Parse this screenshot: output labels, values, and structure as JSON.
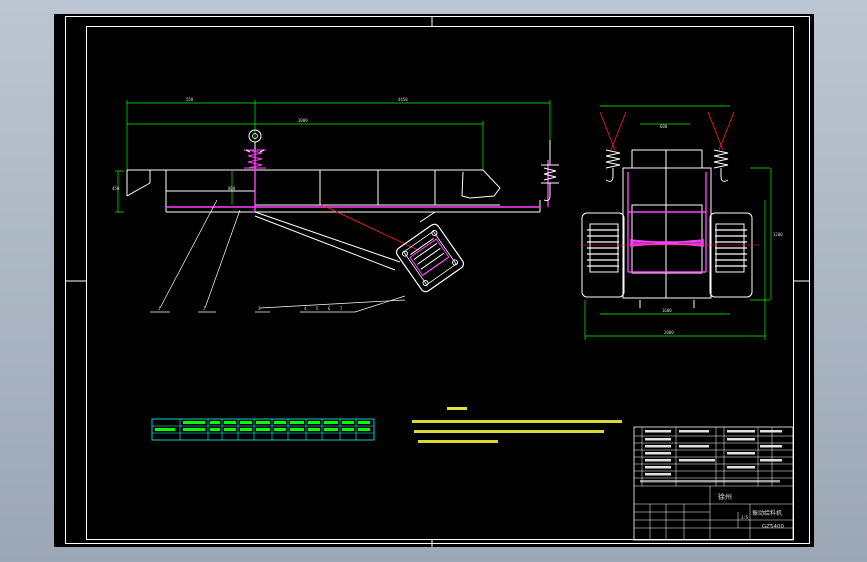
{
  "colors": {
    "background": "#000000",
    "frame": "#ffffff",
    "geometry": "#ffffff",
    "dimension": "#00ff00",
    "highlight": "#ff40ff",
    "centerline": "#ff2020",
    "notes": "#ffff40",
    "table": "#00ffff",
    "viewport": "#a8b2c0"
  },
  "title_block": {
    "company": "徐州",
    "product_name": "振动给料机",
    "drawing_code": "GZ5400",
    "scale": "1:5"
  },
  "icons": {
    "spring": "coil-spring-icon",
    "motor": "vibration-motor-icon",
    "hanger": "suspension-hook-icon"
  }
}
